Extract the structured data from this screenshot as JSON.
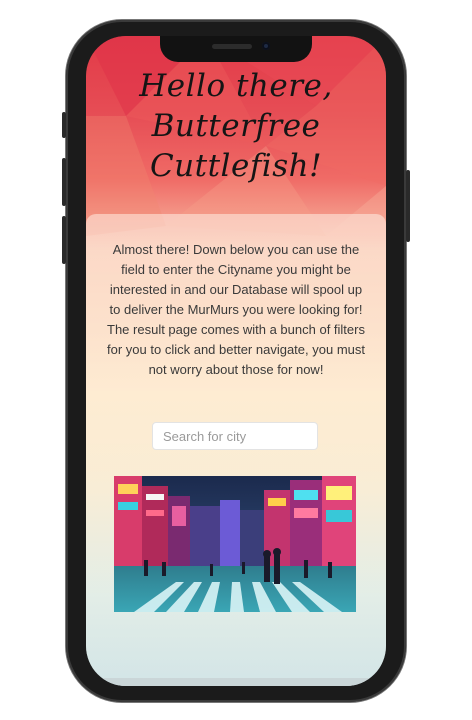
{
  "page": {
    "title_lines": [
      "Hello there,",
      "Butterfree",
      "Cuttlefish!"
    ],
    "intro_text": "Almost there! Down below you can use the field to enter the Cityname you might be interested in and our Database will spool up to deliver the MurMurs you were looking for! The result page comes with a bunch of filters for you to click and better navigate, you must not worry about those for now!",
    "search": {
      "placeholder": "Search for city",
      "value": ""
    },
    "image": {
      "description": "city street crossing photo"
    }
  },
  "colors": {
    "header_red": "#e23a48",
    "body_cream": "#fde7c8",
    "bottom_teal": "#c8dfe3",
    "text_dark": "#151515"
  }
}
